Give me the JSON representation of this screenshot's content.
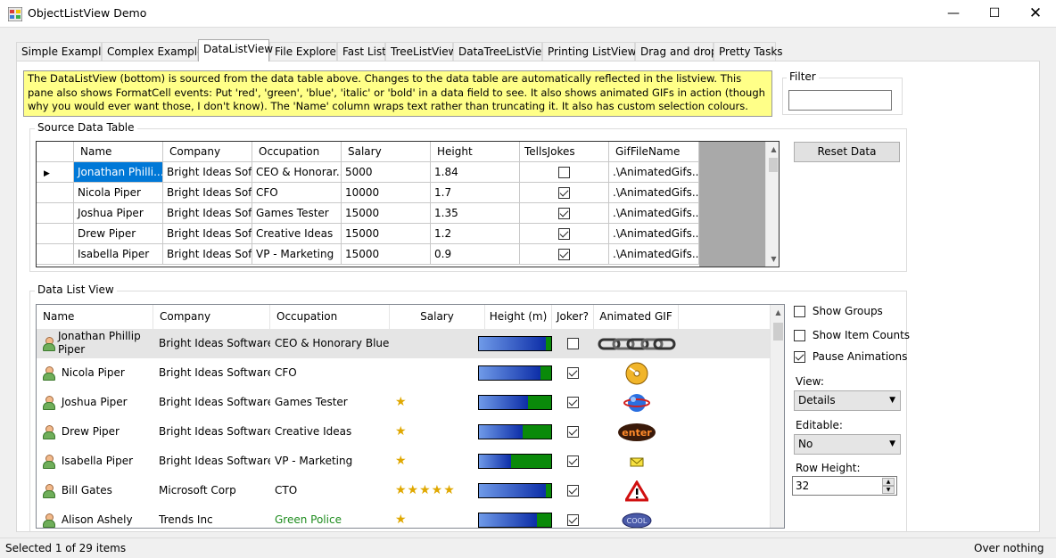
{
  "window": {
    "title": "ObjectListView Demo"
  },
  "tabs": [
    "Simple Example",
    "Complex Example",
    "DataListView",
    "File Explorer",
    "Fast List",
    "TreeListView",
    "DataTreeListView",
    "Printing ListViews",
    "Drag and drop",
    "Pretty Tasks"
  ],
  "description": "The DataListView (bottom) is sourced from the data table above. Changes to the data table are automatically reflected in the listview. This pane also shows FormatCell events: Put 'red', 'green', 'blue', 'italic' or 'bold' in a data field to see. It also shows animated GIFs in action (though why you would ever want those, I don't know). The 'Name' column wraps text rather than truncating it. It also has custom selection colours.",
  "filter": {
    "label": "Filter",
    "value": ""
  },
  "source_table": {
    "label": "Source Data Table",
    "columns": [
      "Name",
      "Company",
      "Occupation",
      "Salary",
      "Height",
      "TellsJokes",
      "GifFileName"
    ],
    "rows": [
      {
        "name": "Jonathan Philli...",
        "company": "Bright Ideas Sof...",
        "occupation": "CEO & Honorar...",
        "salary": "5000",
        "height": "1.84",
        "jokes": false,
        "gif": ".\\AnimatedGifs..."
      },
      {
        "name": "Nicola Piper",
        "company": "Bright Ideas Sof...",
        "occupation": "CFO",
        "salary": "10000",
        "height": "1.7",
        "jokes": true,
        "gif": ".\\AnimatedGifs..."
      },
      {
        "name": "Joshua Piper",
        "company": "Bright Ideas Sof...",
        "occupation": "Games Tester",
        "salary": "15000",
        "height": "1.35",
        "jokes": true,
        "gif": ".\\AnimatedGifs..."
      },
      {
        "name": "Drew Piper",
        "company": "Bright Ideas Sof...",
        "occupation": "Creative Ideas",
        "salary": "15000",
        "height": "1.2",
        "jokes": true,
        "gif": ".\\AnimatedGifs..."
      },
      {
        "name": "Isabella Piper",
        "company": "Bright Ideas Sof...",
        "occupation": "VP - Marketing",
        "salary": "15000",
        "height": "0.9",
        "jokes": true,
        "gif": ".\\AnimatedGifs..."
      }
    ]
  },
  "reset_button": "Reset Data",
  "data_list": {
    "label": "Data List View",
    "columns": [
      "Name",
      "Company",
      "Occupation",
      "Salary",
      "Height (m)",
      "Joker?",
      "Animated GIF"
    ],
    "rows": [
      {
        "name": "Jonathan Phillip Piper",
        "company": "Bright Ideas Software",
        "occupation": "CEO & Honorary Blue ...",
        "stars": "",
        "height_fraction": 0.92,
        "joker": false,
        "gif": "chain-gif-icon",
        "occ_color": "#000000"
      },
      {
        "name": "Nicola Piper",
        "company": "Bright Ideas Software",
        "occupation": "CFO",
        "stars": "",
        "height_fraction": 0.85,
        "joker": true,
        "gif": "cd-gif-icon",
        "occ_color": "#000000"
      },
      {
        "name": "Joshua Piper",
        "company": "Bright Ideas Software",
        "occupation": "Games Tester",
        "stars": "★",
        "height_fraction": 0.68,
        "joker": true,
        "gif": "globe-gif-icon",
        "occ_color": "#000000"
      },
      {
        "name": "Drew Piper",
        "company": "Bright Ideas Software",
        "occupation": "Creative Ideas",
        "stars": "★",
        "height_fraction": 0.6,
        "joker": true,
        "gif": "enter-gif-icon",
        "occ_color": "#000000"
      },
      {
        "name": "Isabella Piper",
        "company": "Bright Ideas Software",
        "occupation": "VP - Marketing",
        "stars": "★",
        "height_fraction": 0.45,
        "joker": true,
        "gif": "envelope-gif-icon",
        "occ_color": "#000000"
      },
      {
        "name": "Bill Gates",
        "company": "Microsoft Corp",
        "occupation": "CTO",
        "stars": "★★★★★",
        "height_fraction": 0.93,
        "joker": true,
        "gif": "warning-gif-icon",
        "occ_color": "#000000"
      },
      {
        "name": "Alison Ashely",
        "company": "Trends Inc",
        "occupation": "Green Police",
        "stars": "★",
        "height_fraction": 0.8,
        "joker": true,
        "gif": "cool-gif-icon",
        "occ_color": "#1e8c1e"
      }
    ]
  },
  "options": {
    "show_groups": {
      "label": "Show Groups",
      "checked": false
    },
    "show_item_counts": {
      "label": "Show Item Counts",
      "checked": false
    },
    "pause_animations": {
      "label": "Pause Animations",
      "checked": true
    },
    "view_label": "View:",
    "view_value": "Details",
    "editable_label": "Editable:",
    "editable_value": "No",
    "row_height_label": "Row Height:",
    "row_height_value": "32"
  },
  "status": {
    "left": "Selected 1 of 29 items",
    "right": "Over nothing"
  }
}
